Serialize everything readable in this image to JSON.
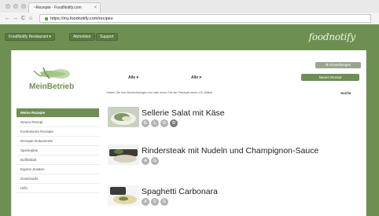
{
  "browser": {
    "tab_title": "~Rezepte - FoodNotify.com",
    "tab_close": "×",
    "url": "https://my.foodnotify.com/recipes",
    "nav": [
      "←",
      "→",
      "C",
      "⌂"
    ]
  },
  "appbar": {
    "buttons": [
      "FoodNotify Restaurant ▾",
      "Abmelden",
      "Support"
    ],
    "brand": "foodnotify"
  },
  "header": {
    "logo_text": "MeinBetrieb",
    "dropdowns": [
      "Alle ▾",
      "Alle ▾"
    ],
    "settings_button": "⚙ Einstellungen",
    "new_button": "Neues Rezept",
    "hint": "Geben Sie hier Bezeichnungen ein oder einen Teil der Rezepte wenn z.B. Artikel",
    "search_label": "Suche"
  },
  "sidebar": {
    "items": [
      {
        "label": "Meine Rezepte",
        "active": true
      },
      {
        "label": "Neues Rezept",
        "active": false
      },
      {
        "label": "Kombinierte Rezepte",
        "active": false
      },
      {
        "label": "Rezepte Dokumente",
        "active": false
      },
      {
        "label": "Speiseplan",
        "active": false
      },
      {
        "label": "Buffetblatt",
        "active": false
      },
      {
        "label": "Eigene Zutaten",
        "active": false
      },
      {
        "label": "Downloads",
        "active": false
      },
      {
        "label": "Hilfe",
        "active": false
      }
    ]
  },
  "recipes": [
    {
      "title": "Sellerie Salat mit Käse",
      "badges": [
        "G",
        "L",
        "O",
        "D"
      ]
    },
    {
      "title": "Rindersteak mit Nudeln und Champignon-Sauce",
      "badges": [
        "A",
        "G"
      ]
    },
    {
      "title": "Spaghetti Carbonara",
      "badges": [
        "A",
        "C",
        "G"
      ]
    }
  ],
  "colors": {
    "accent": "#6e8f52",
    "badge": "#b3b3b3"
  }
}
